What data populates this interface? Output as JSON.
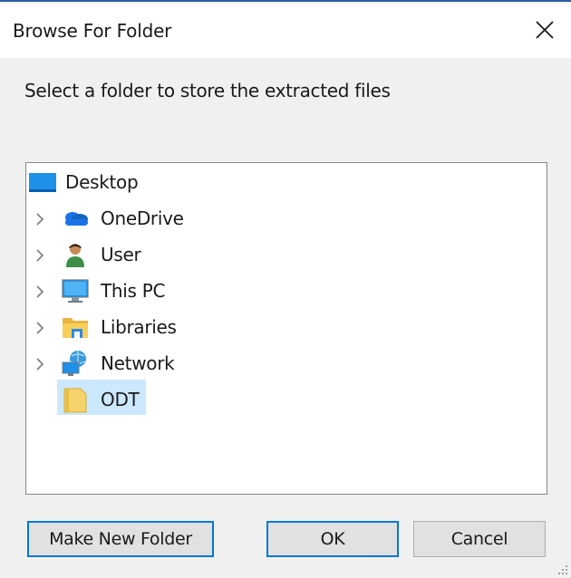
{
  "window": {
    "title": "Browse For Folder",
    "close_icon": "close-icon"
  },
  "instruction": "Select a folder to store the extracted files",
  "tree": {
    "items": [
      {
        "label": "Desktop",
        "icon": "desktop-icon",
        "expandable": false
      },
      {
        "label": "OneDrive",
        "icon": "cloud-icon",
        "expandable": true
      },
      {
        "label": "User",
        "icon": "user-icon",
        "expandable": true
      },
      {
        "label": "This PC",
        "icon": "computer-icon",
        "expandable": true
      },
      {
        "label": "Libraries",
        "icon": "libraries-icon",
        "expandable": true
      },
      {
        "label": "Network",
        "icon": "network-icon",
        "expandable": true
      },
      {
        "label": "ODT",
        "icon": "folder-icon",
        "expandable": false,
        "selected": true
      }
    ]
  },
  "buttons": {
    "make_new_folder": "Make New Folder",
    "ok": "OK",
    "cancel": "Cancel"
  },
  "colors": {
    "accent": "#0078d7",
    "selection": "#cce8ff",
    "title_border": "#2b5ea1"
  }
}
